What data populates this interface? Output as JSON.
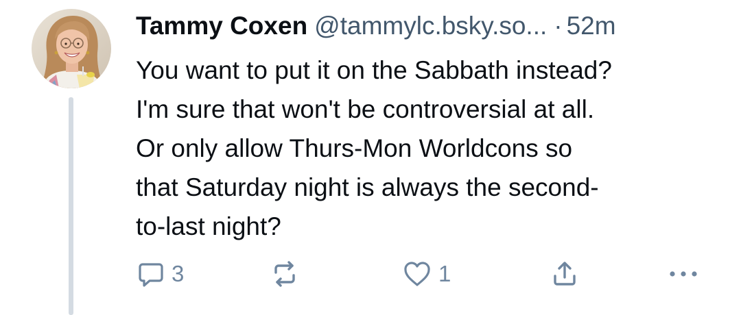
{
  "post": {
    "author": {
      "display_name": "Tammy Coxen",
      "handle": "@tammylc.bsky.so..."
    },
    "separator": "·",
    "time": "52m",
    "text": "You want to put it on the Sabbath instead?\nI'm sure that won't be controversial at all.\nOr only allow Thurs-Mon Worldcons so\nthat Saturday night is always the second-\nto-last night?",
    "actions": {
      "reply": {
        "icon": "comment-icon",
        "count": "3"
      },
      "repost": {
        "icon": "repost-icon",
        "count": ""
      },
      "like": {
        "icon": "heart-icon",
        "count": "1"
      },
      "share": {
        "icon": "share-icon"
      },
      "more": {
        "icon": "more-options-icon"
      }
    }
  },
  "colors": {
    "text_primary": "#0b0f14",
    "text_secondary": "#42576c",
    "icon_muted": "#6f869f",
    "thread_line": "#d4dbe2"
  }
}
